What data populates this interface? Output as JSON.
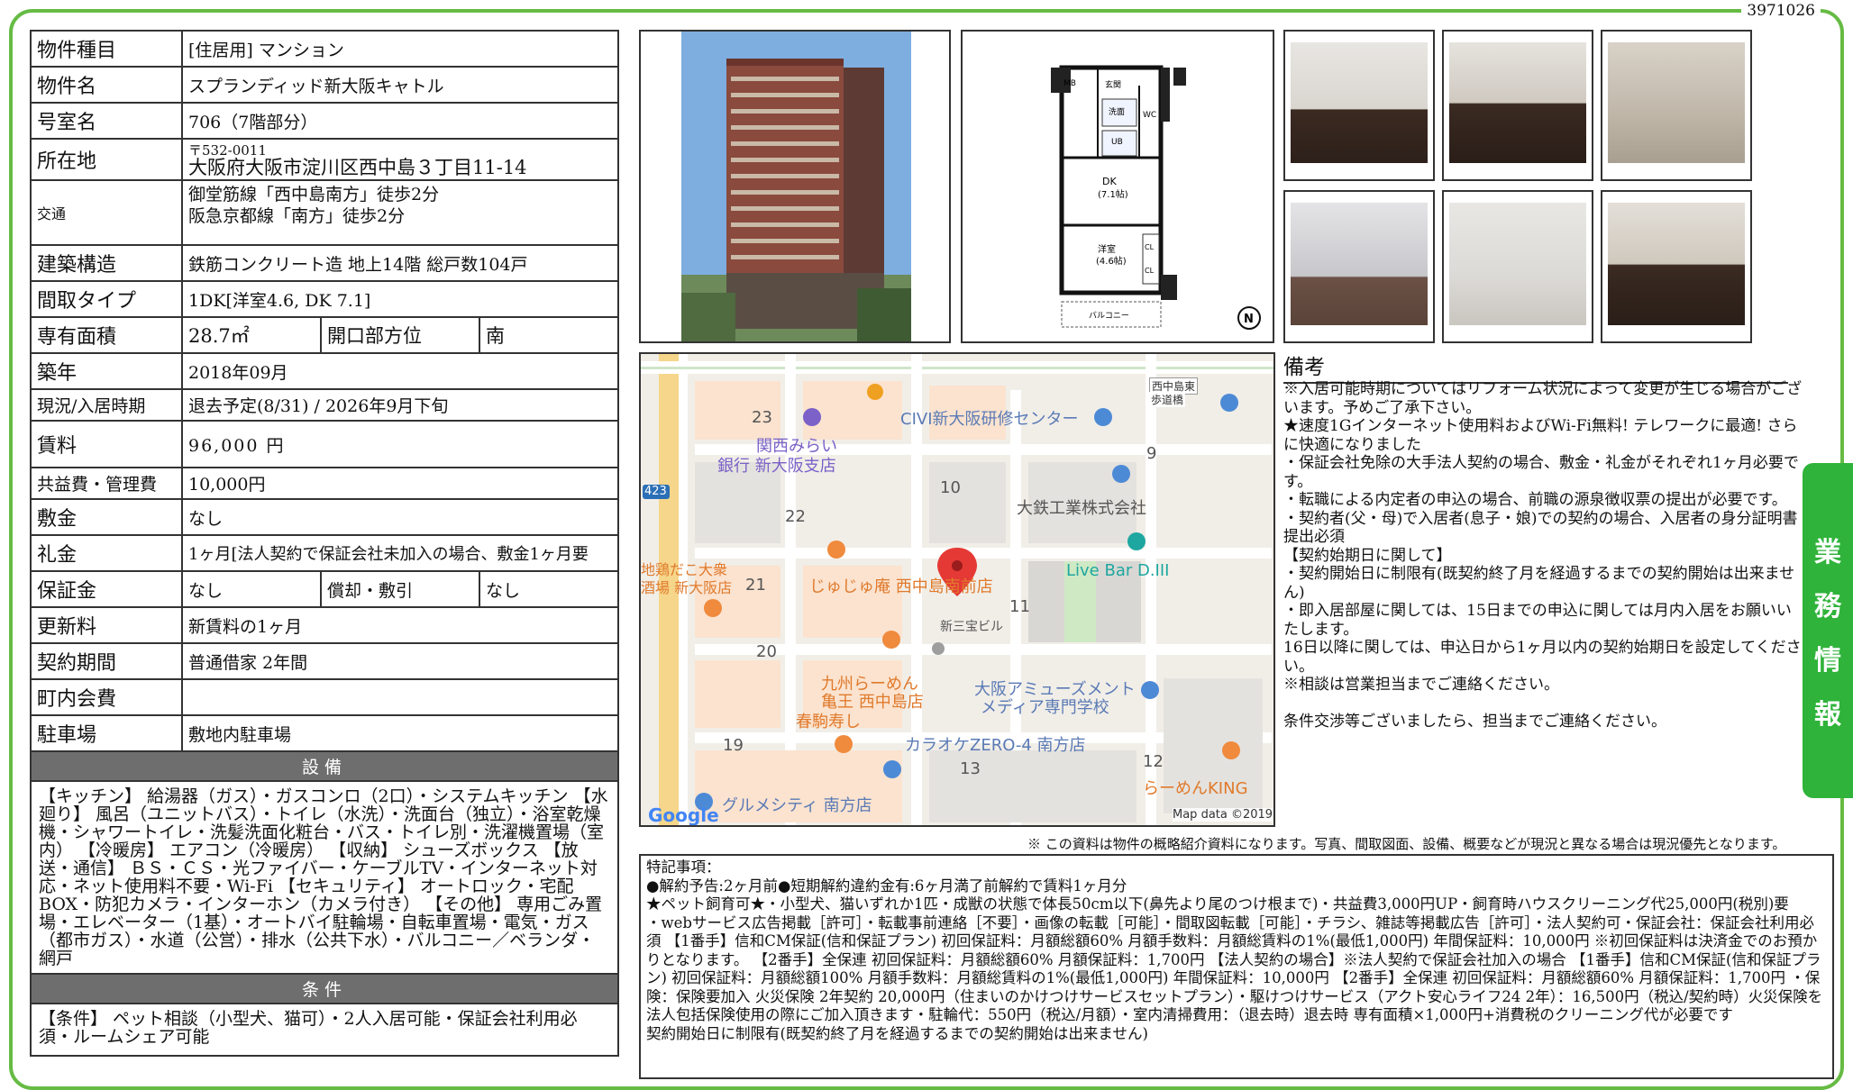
{
  "doc_id": "3971026",
  "spec": {
    "type_label": "物件種目",
    "type_value": "[住居用]  マンション",
    "name_label": "物件名",
    "name_value": "スプランディッド新大阪キャトル",
    "room_label": "号室名",
    "room_value": "706（7階部分）",
    "address_label": "所在地",
    "postal": "〒532-0011",
    "address_value": "大阪府大阪市淀川区西中島３丁目11-14",
    "transit_label": "交通",
    "transit_1": "御堂筋線「西中島南方」徒歩2分",
    "transit_2": "阪急京都線「南方」徒歩2分",
    "structure_label": "建築構造",
    "structure_value": "鉄筋コンクリート造 地上14階 総戸数104戸",
    "layout_label": "間取タイプ",
    "layout_value": "1DK[洋室4.6, DK 7.1]",
    "area_label": "専有面積",
    "area_value": "28.7㎡",
    "opening_label": "開口部方位",
    "opening_value": "南",
    "built_label": "築年",
    "built_value": "2018年09月",
    "status_label": "現況/入居時期",
    "status_value": "退去予定(8/31)  /  2026年9月下旬",
    "rent_label": "賃料",
    "rent_value": "96,000 円",
    "fee_label": "共益費・管理費",
    "fee_value": "10,000円",
    "deposit_label": "敷金",
    "deposit_value": "なし",
    "keymoney_label": "礼金",
    "keymoney_value": "1ヶ月[法人契約で保証会社未加入の場合、敷金1ヶ月要",
    "guarantee_label": "保証金",
    "guarantee_value": "なし",
    "amort_label": "償却・敷引",
    "amort_value": "なし",
    "renewal_label": "更新料",
    "renewal_value": "新賃料の1ヶ月",
    "contract_label": "契約期間",
    "contract_value": "普通借家  2年間",
    "town_label": "町内会費",
    "town_value": "",
    "parking_label": "駐車場",
    "parking_value": "敷地内駐車場",
    "facilities_head": "設備",
    "facilities_text": "【キッチン】 給湯器（ガス）・ガスコンロ（2口）・システムキッチン 【水廻り】 風呂（ユニットバス）・トイレ（水洗）・洗面台（独立）・浴室乾燥機・シャワートイレ・洗髪洗面化粧台・バス・トイレ別・洗濯機置場（室内） 【冷暖房】 エアコン（冷暖房） 【収納】 シューズボックス 【放送・通信】 ＢＳ・ＣＳ・光ファイバー・ケーブルTV・インターネット対応・ネット使用料不要・Wi-Fi 【セキュリティ】 オートロック・宅配BOX・防犯カメラ・インターホン（カメラ付き） 【その他】 専用ごみ置場・エレベーター（1基）・オートバイ駐輪場・自転車置場・電気・ガス（都市ガス）・水道（公営）・排水（公共下水）・バルコニー／ベランダ・網戸",
    "conditions_head": "条件",
    "conditions_text": "【条件】 ペット相談（小型犬、猫可）・2人入居可能・保証会社利用必須・ルームシェア可能"
  },
  "floorplan": {
    "mb": "MB",
    "entrance": "玄関",
    "wash": "洗面",
    "ub": "UB",
    "wc": "WC",
    "dk": "DK",
    "dk_size": "(7.1帖)",
    "room": "洋室",
    "room_size": "(4.6帖)",
    "cl1": "CL",
    "cl2": "CL",
    "balcony": "バルコニー",
    "north": "N"
  },
  "map": {
    "labels": {
      "civi": "CIVI新大阪研修センター",
      "kansai1": "関西みらい",
      "kansai2": "銀行 新大阪支店",
      "daitetsu": "大鉄工業株式会社",
      "livebar": "Live Bar D.III",
      "jujuan": "じゅじゅ庵 西中島南前店",
      "jidori1": "地鶏だこ大衆",
      "jidori2": "酒場 新大阪店",
      "sanpo": "新三宝ビル",
      "kyushu1": "九州らーめん",
      "kyushu2": "亀王 西中島店",
      "harukoma": "春駒寿し",
      "amuse1": "大阪アミューズメント",
      "amuse2": "メディア専門学校",
      "karaoke": "カラオケZERO-4 南方店",
      "ramenking": "らーめんKING",
      "gourmet": "グルメシティ 南方店",
      "bridge1": "西中島東",
      "bridge2": "歩道橋",
      "route": "423",
      "google": "Google",
      "mapdata": "Map data ©2019"
    },
    "blocks": [
      "23",
      "9",
      "10",
      "22",
      "21",
      "11",
      "20",
      "19",
      "13",
      "12"
    ]
  },
  "remarks": {
    "title": "備考",
    "lines": [
      "※入居可能時期についてはリフォーム状況によって変更が生じる場合がございます。予めご了承下さい。",
      "★速度1Gインターネット使用料およびWi-Fi無料! テレワークに最適! さらに快適になりました",
      "・保証会社免除の大手法人契約の場合、敷金・礼金がそれぞれ1ヶ月必要です。",
      "・転職による内定者の申込の場合、前職の源泉徴収票の提出が必要です。",
      "・契約者(父・母)で入居者(息子・娘)での契約の場合、入居者の身分証明書提出必須",
      "【契約始期日に関して】",
      "・契約開始日に制限有(既契約終了月を経過するまでの契約開始は出来ません)",
      "・即入居部屋に関しては、15日までの申込に関しては月内入居をお願いいたします。",
      "16日以降に関しては、申込日から1ヶ月以内の契約始期日を設定してください。",
      "※相談は営業担当までご連絡ください。",
      "",
      "条件交渉等ございましたら、担当までご連絡ください。"
    ]
  },
  "side_tab": [
    "業",
    "務",
    "情",
    "報"
  ],
  "disclaimer": "※ この資料は物件の概略紹介資料になります。写真、間取図面、設備、概要などが現況と異なる場合は現況優先となります。",
  "notes": {
    "lines": [
      "特記事項：",
      "●解約予告:2ヶ月前●短期解約違約金有:6ヶ月満了前解約で賃料1ヶ月分",
      "★ペット飼育可★・小型犬、猫いずれか1匹・成獣の状態で体長50cm以下(鼻先より尾のつけ根まで)・共益費3,000円UP・飼育時ハウスクリーニング代25,000円(税別)要",
      "・webサービス広告掲載［許可］・転載事前連絡［不要］・画像の転載［可能］・間取図転載［可能］・チラシ、雑誌等掲載広告［許可］・法人契約可・保証会社：保証会社利用必須 【1番手】信和CM保証(信和保証プラン)  初回保証料：月額総額60%  月額手数料：月額総賃料の1%(最低1,000円)  年間保証料：10,000円  ※初回保証料は決済金でのお預かりとなります。  【2番手】全保連  初回保証料：月額総額60%  月額保証料：1,700円  【法人契約の場合】※法人契約で保証会社加入の場合  【1番手】信和CM保証(信和保証プラン)  初回保証料：月額総額100%  月額手数料：月額総賃料の1%(最低1,000円)  年間保証料：10,000円  【2番手】全保連  初回保証料：月額総額60%  月額保証料：1,700円 ・保険：保険要加入 火災保険 2年契約 20,000円（住まいのかけつけサービスセットプラン）・駆けつけサービス（アクト安心ライフ24  2年）：16,500円（税込/契約時）火災保険を法人包括保険使用の際にご加入頂きます・駐輪代：550円（税込/月額）・室内清掃費用：（退去時）退去時  専有面積×1,000円+消費税のクリーニング代が必要です",
      "契約開始日に制限有(既契約終了月を経過するまでの契約開始は出来ません)"
    ]
  }
}
